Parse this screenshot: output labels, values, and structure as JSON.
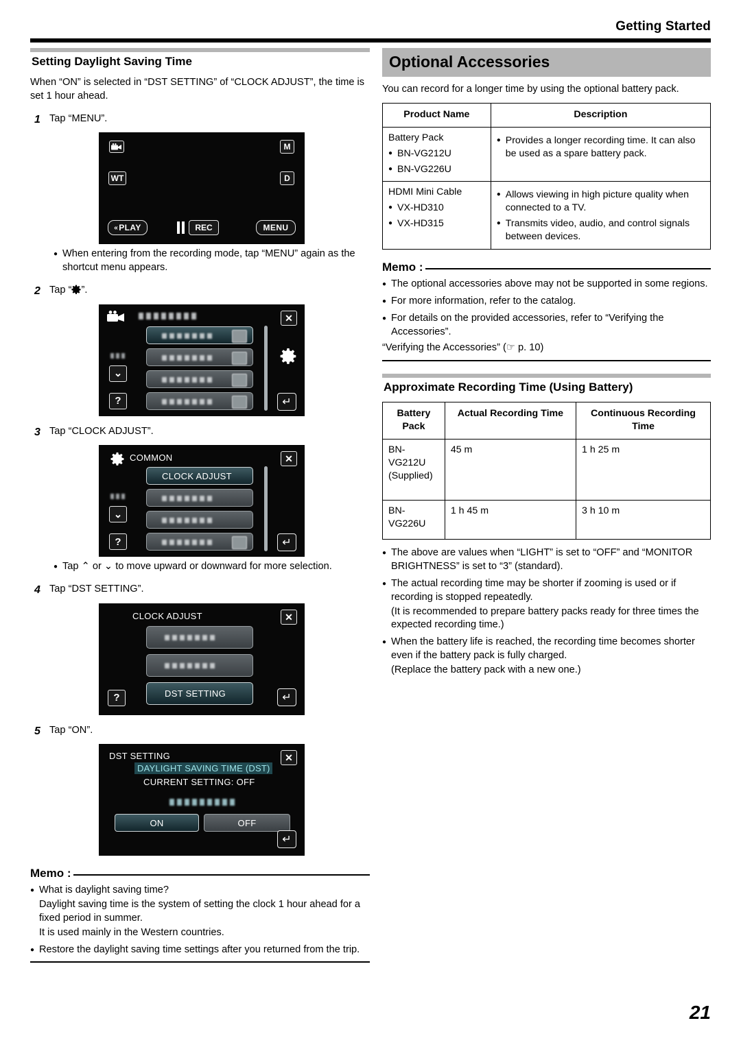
{
  "header": {
    "running_head": "Getting Started"
  },
  "page_number": "21",
  "left_column": {
    "section_title": "Setting Daylight Saving Time",
    "intro": "When “ON” is selected in “DST SETTING” of “CLOCK ADJUST”, the time is set 1 hour ahead.",
    "steps": [
      {
        "num": "1",
        "text": "Tap “MENU”."
      },
      {
        "num": "2",
        "text_before": "Tap “",
        "icon": "gear-icon",
        "text_after": "”."
      },
      {
        "num": "3",
        "text": "Tap “CLOCK ADJUST”."
      },
      {
        "num": "4",
        "text": "Tap “DST SETTING”."
      },
      {
        "num": "5",
        "text": "Tap “ON”."
      }
    ],
    "note_after_step1": "When entering from the recording mode, tap “MENU” again as the shortcut menu appears.",
    "note_after_step3_before": "Tap ",
    "note_after_step3_mid": " or ",
    "note_after_step3_after": " to move upward or downward for more selection.",
    "memo": {
      "label": "Memo :",
      "items": [
        {
          "text": "What is daylight saving time?",
          "sub": [
            "Daylight saving time is the system of setting the clock 1 hour ahead for a fixed period in summer.",
            "It is used mainly in the Western countries."
          ]
        },
        {
          "text": "Restore the daylight saving time settings after you returned from the trip.",
          "sub": []
        }
      ]
    }
  },
  "screens": {
    "s1": {
      "name": "recording-standby-screen",
      "icons": {
        "mode": "video-camera-icon",
        "zoom": "WT",
        "manual": "M",
        "display": "D"
      },
      "buttons": {
        "play": "PLAY",
        "rec": "REC",
        "menu": "MENU"
      }
    },
    "s2": {
      "name": "main-menu-screen",
      "title_blurred": true,
      "left_icons": {
        "mode": "video-camera-icon",
        "page": "1/3",
        "down": "down-arrow-icon",
        "help": "?"
      },
      "right_icons": {
        "close": "close-icon",
        "gear": "gear-icon",
        "back": "back-arrow-icon"
      },
      "rows": 4
    },
    "s3": {
      "name": "common-menu-screen",
      "title": "COMMON",
      "selected_row": "CLOCK ADJUST",
      "left_icons": {
        "page": "1/3",
        "down": "down-arrow-icon",
        "help": "?"
      },
      "right_icons": {
        "close": "close-icon",
        "back": "back-arrow-icon"
      },
      "rows": 4
    },
    "s4": {
      "name": "clock-adjust-screen",
      "title": "CLOCK ADJUST",
      "selected_row": "DST SETTING",
      "left_icons": {
        "help": "?"
      },
      "right_icons": {
        "close": "close-icon",
        "back": "back-arrow-icon"
      },
      "rows": 3
    },
    "s5": {
      "name": "dst-setting-screen",
      "title": "DST SETTING",
      "highlight": "DAYLIGHT SAVING TIME (DST)",
      "current_setting": "CURRENT SETTING: OFF",
      "option_on": "ON",
      "option_off": "OFF",
      "right_icons": {
        "close": "close-icon",
        "back": "back-arrow-icon"
      }
    }
  },
  "right_column": {
    "section_title": "Optional Accessories",
    "intro": "You can record for a longer time by using the optional battery pack.",
    "accessories_table": {
      "headers": [
        "Product Name",
        "Description"
      ],
      "rows": [
        {
          "product_title": "Battery Pack",
          "product_items": [
            "BN-VG212U",
            "BN-VG226U"
          ],
          "description_items": [
            "Provides a longer recording time. It can also be used as a spare battery pack."
          ]
        },
        {
          "product_title": "HDMI Mini Cable",
          "product_items": [
            "VX-HD310",
            "VX-HD315"
          ],
          "description_items": [
            "Allows viewing in high picture quality when connected to a TV.",
            "Transmits video, audio, and control signals between devices."
          ]
        }
      ]
    },
    "memo": {
      "label": "Memo :",
      "items": [
        "The optional accessories above may not be supported in some regions.",
        "For more information, refer to the catalog.",
        "For details on the provided accessories, refer to “Verifying the Accessories”."
      ],
      "reference_before": "“Verifying the Accessories” (",
      "reference_icon": "pointing-hand-icon",
      "reference_after": " p. 10)"
    },
    "recording_time": {
      "section_title": "Approximate Recording Time (Using Battery)",
      "headers": [
        "Battery Pack",
        "Actual Recording Time",
        "Continuous Recording Time"
      ],
      "rows": [
        {
          "battery": "BN-VG212U (Supplied)",
          "actual": "45 m",
          "continuous": "1 h 25 m"
        },
        {
          "battery": "BN-VG226U",
          "actual": "1 h 45 m",
          "continuous": "3 h 10 m"
        }
      ],
      "notes": [
        {
          "text": "The above are values when “LIGHT” is set to “OFF” and “MONITOR BRIGHTNESS” is set to “3” (standard).",
          "sub": []
        },
        {
          "text": "The actual recording time may be shorter if zooming is used or if recording is stopped repeatedly.",
          "sub": [
            "(It is recommended to prepare battery packs ready for three times the expected recording time.)"
          ]
        },
        {
          "text": "When the battery life is reached, the recording time becomes shorter even if the battery pack is fully charged.",
          "sub": [
            "(Replace the battery pack with a new one.)"
          ]
        }
      ]
    }
  }
}
